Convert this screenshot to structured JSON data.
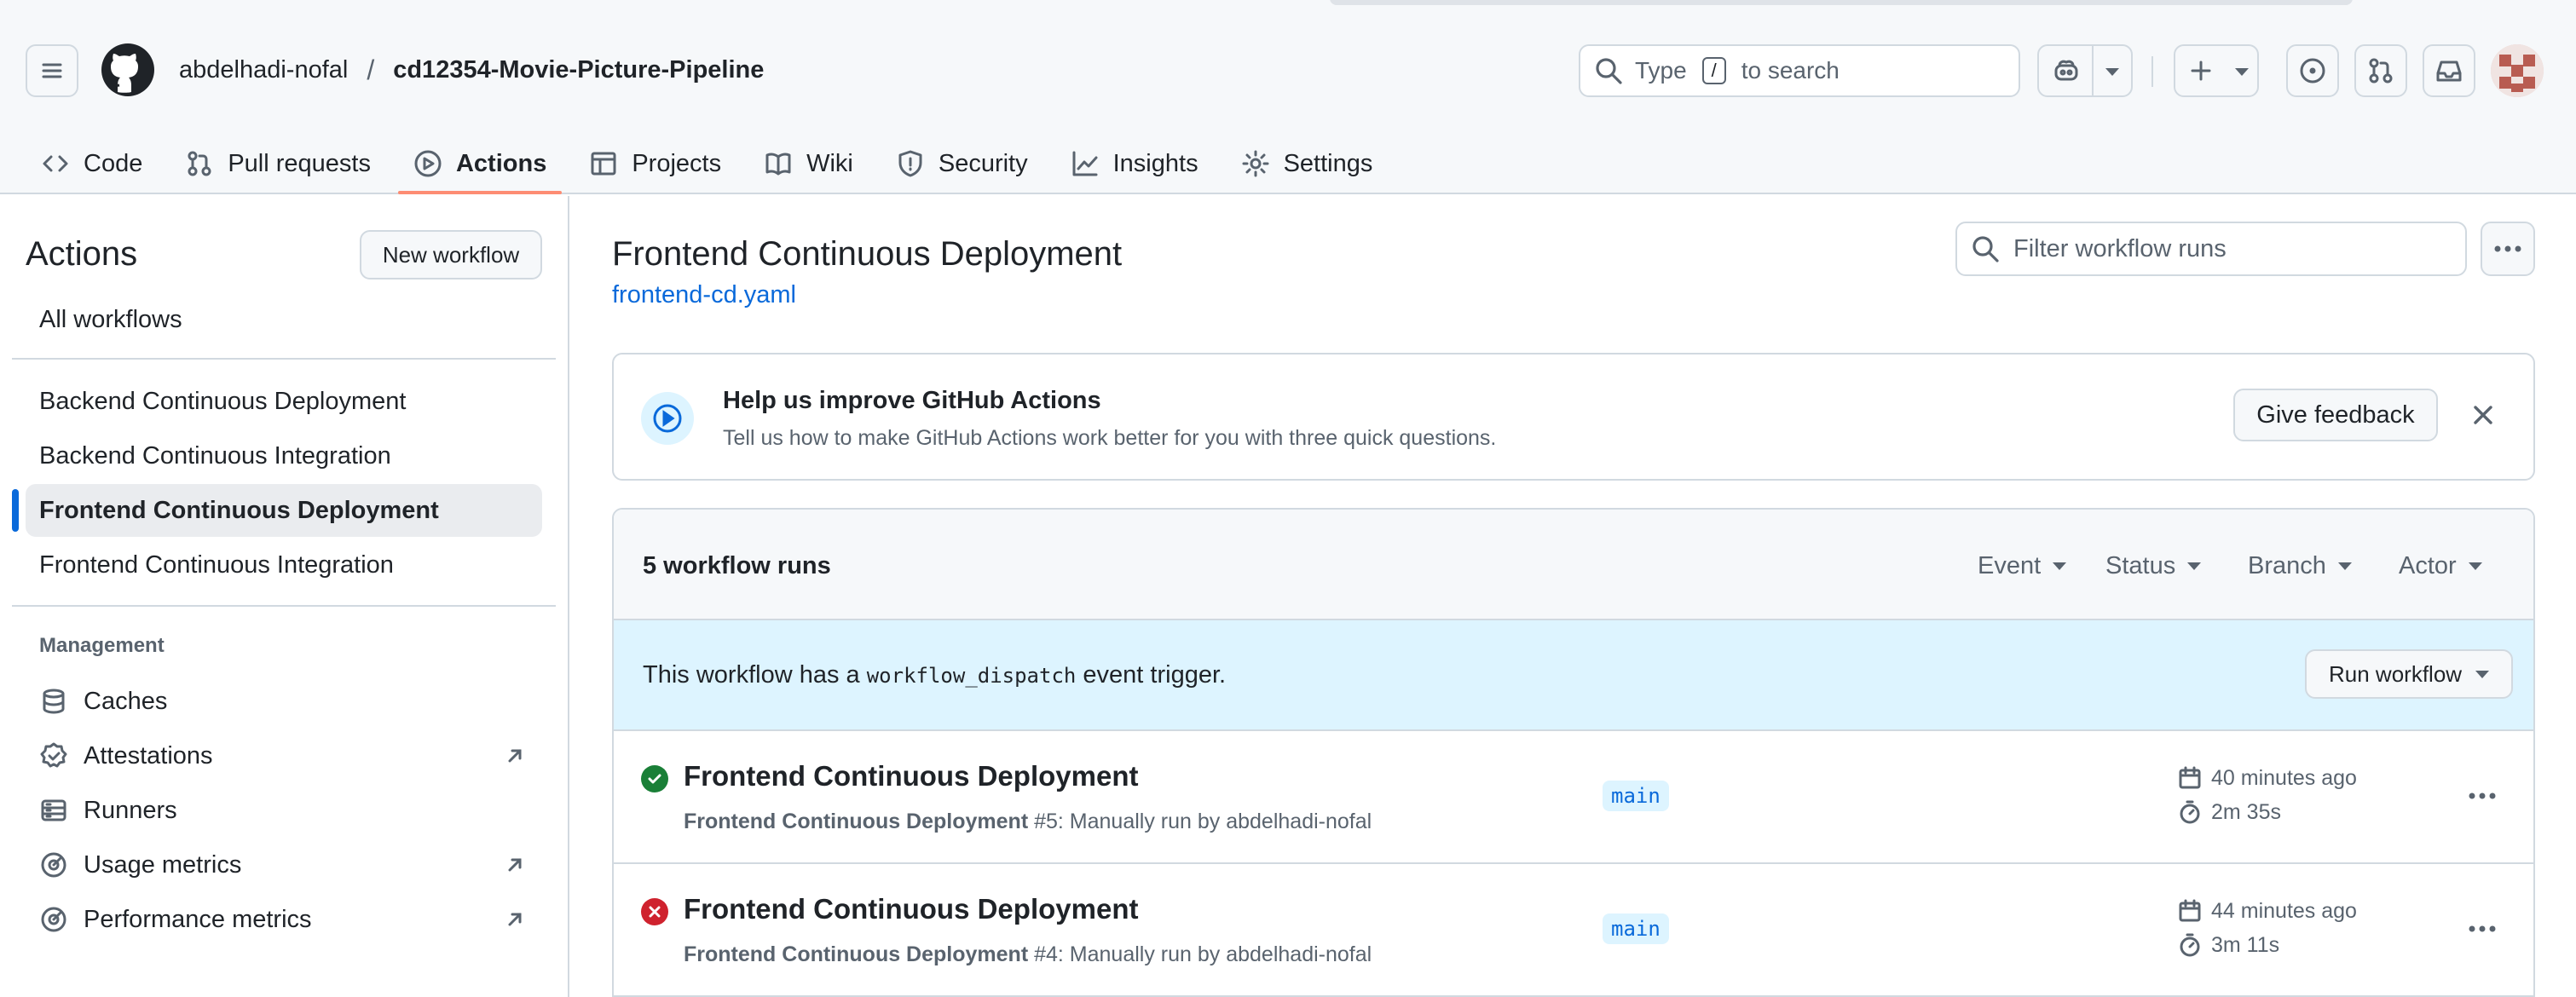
{
  "header": {
    "owner": "abdelhadi-nofal",
    "separator": "/",
    "repo": "cd12354-Movie-Picture-Pipeline",
    "search_prefix": "Type",
    "search_key": "/",
    "search_suffix": "to search"
  },
  "tabs": [
    {
      "label": "Code",
      "icon": "code-icon"
    },
    {
      "label": "Pull requests",
      "icon": "pull-request-icon"
    },
    {
      "label": "Actions",
      "icon": "play-icon",
      "active": true
    },
    {
      "label": "Projects",
      "icon": "table-icon"
    },
    {
      "label": "Wiki",
      "icon": "book-icon"
    },
    {
      "label": "Security",
      "icon": "shield-icon"
    },
    {
      "label": "Insights",
      "icon": "graph-icon"
    },
    {
      "label": "Settings",
      "icon": "gear-icon"
    }
  ],
  "sidebar": {
    "title": "Actions",
    "new_workflow": "New workflow",
    "all_workflows": "All workflows",
    "workflows": [
      "Backend Continuous Deployment",
      "Backend Continuous Integration",
      "Frontend Continuous Deployment",
      "Frontend Continuous Integration"
    ],
    "selected_index": 2,
    "management_label": "Management",
    "management": [
      {
        "label": "Caches",
        "icon": "database-icon",
        "external": false
      },
      {
        "label": "Attestations",
        "icon": "verified-icon",
        "external": true
      },
      {
        "label": "Runners",
        "icon": "server-icon",
        "external": false
      },
      {
        "label": "Usage metrics",
        "icon": "meter-icon",
        "external": true
      },
      {
        "label": "Performance metrics",
        "icon": "meter-icon",
        "external": true
      }
    ]
  },
  "main": {
    "title": "Frontend Continuous Deployment",
    "file": "frontend-cd.yaml",
    "filter_placeholder": "Filter workflow runs",
    "feedback": {
      "title": "Help us improve GitHub Actions",
      "subtitle": "Tell us how to make GitHub Actions work better for you with three quick questions.",
      "button": "Give feedback"
    },
    "runs_count": "5 workflow runs",
    "filters": [
      "Event",
      "Status",
      "Branch",
      "Actor"
    ],
    "dispatch": {
      "prefix": "This workflow has a",
      "code": "workflow_dispatch",
      "suffix": "event trigger.",
      "button": "Run workflow"
    },
    "runs": [
      {
        "title": "Frontend Continuous Deployment",
        "meta_bold": "Frontend Continuous Deployment",
        "meta_rest": "#5: Manually run by abdelhadi-nofal",
        "branch": "main",
        "time": "40 minutes ago",
        "duration": "2m 35s",
        "status": "success"
      },
      {
        "title": "Frontend Continuous Deployment",
        "meta_bold": "Frontend Continuous Deployment",
        "meta_rest": "#4: Manually run by abdelhadi-nofal",
        "branch": "main",
        "time": "44 minutes ago",
        "duration": "3m 11s",
        "status": "failure"
      }
    ]
  },
  "colors": {
    "accent_blue": "#0969da",
    "success": "#1a7f37",
    "failure": "#cf222e",
    "tab_underline": "#fd8c73"
  }
}
